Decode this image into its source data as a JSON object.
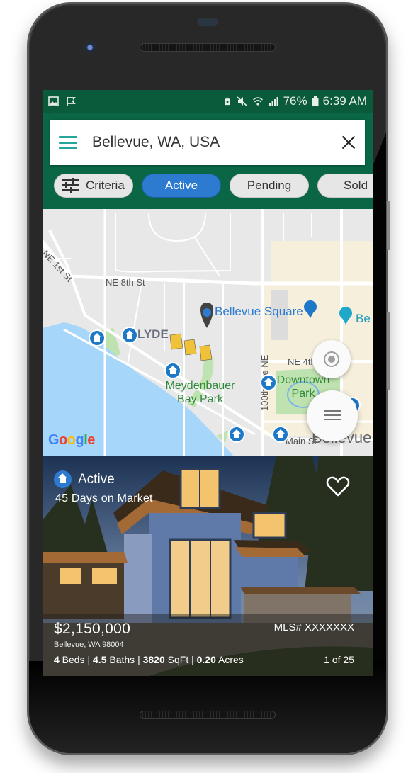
{
  "status_bar": {
    "left_icons": [
      "image-icon",
      "check-flag-icon"
    ],
    "right_icons": [
      "battery-saver-icon",
      "mute-icon",
      "wifi-icon",
      "signal-icon",
      "battery-icon"
    ],
    "battery": "76%",
    "time": "6:39 AM"
  },
  "search": {
    "value": "Bellevue, WA, USA",
    "menu_icon": "hamburger-menu-icon",
    "clear_icon": "close-icon"
  },
  "filters": [
    {
      "label": "Criteria",
      "icon": "tune-icon",
      "selected": false
    },
    {
      "label": "Active",
      "selected": true
    },
    {
      "label": "Pending",
      "selected": false
    },
    {
      "label": "Sold",
      "selected": false
    }
  ],
  "colors": {
    "header_green": "#0a6645",
    "status_green": "#0a5a3c",
    "accent_blue": "#2d7bd0",
    "menu_teal": "#26a69a"
  },
  "map": {
    "street_labels": [
      "NE 1st St",
      "NE 8th St",
      "NE 4th",
      "100th Ave NE",
      "Main St"
    ],
    "poi_labels": [
      "Bellevue Square",
      "Be"
    ],
    "park_labels": [
      "Meydenbauer Bay Park",
      "Downtown Park"
    ],
    "neighborhood_label": "LYDE",
    "city_label": "Bellevue",
    "attribution": "Google",
    "buttons": {
      "my_location": "crosshair-target-icon",
      "list_view": "list-icon"
    }
  },
  "listing": {
    "status": "Active",
    "days_on_market": "45 Days on Market",
    "price": "$2,150,000",
    "mls": "MLS# XXXXXXX",
    "address": "Bellevue, WA  98004",
    "beds": "4",
    "beds_label": " Beds | ",
    "baths": "4.5",
    "baths_label": " Baths | ",
    "sqft": "3820",
    "sqft_label": " SqFt | ",
    "acres": "0.20",
    "acres_label": " Acres",
    "position": "1 of 25",
    "favorite": false
  }
}
